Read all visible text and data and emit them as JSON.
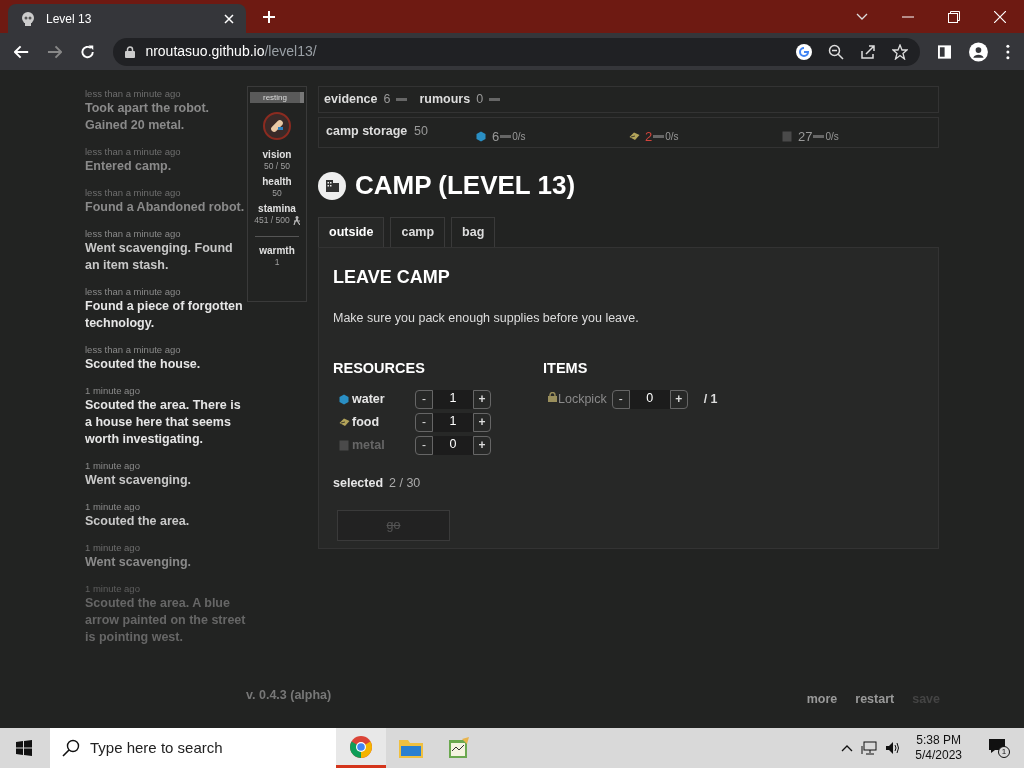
{
  "browser": {
    "tab_title": "Level 13",
    "url_host": "nroutasuo.github.io",
    "url_path": "/level13/"
  },
  "log": [
    {
      "time": "less than a minute ago",
      "text": "Took apart the robot. Gained 20 metal.",
      "kind": "dim"
    },
    {
      "time": "less than a minute ago",
      "text": "Entered camp.",
      "kind": "dim"
    },
    {
      "time": "less than a minute ago",
      "text": "Found a Abandoned robot.",
      "kind": "dim"
    },
    {
      "time": "less than a minute ago",
      "text": "Went scavenging. Found an item stash.",
      "kind": "normal"
    },
    {
      "time": "less than a minute ago",
      "text": "Found a piece of forgotten technology.",
      "kind": "bright"
    },
    {
      "time": "less than a minute ago",
      "text": "Scouted the house.",
      "kind": "bright"
    },
    {
      "time": "1 minute ago",
      "text": "Scouted the area. There is a house here that seems worth investigating.",
      "kind": "bright"
    },
    {
      "time": "1 minute ago",
      "text": "Went scavenging.",
      "kind": "normal"
    },
    {
      "time": "1 minute ago",
      "text": "Scouted the area.",
      "kind": "normal"
    },
    {
      "time": "1 minute ago",
      "text": "Went scavenging.",
      "kind": "dim"
    },
    {
      "time": "1 minute ago",
      "text": "Scouted the area. A blue arrow painted on the street is pointing west.",
      "kind": "faint"
    }
  ],
  "status": {
    "badge": "resting",
    "stats": [
      {
        "label": "vision",
        "value": "50 / 50"
      },
      {
        "label": "health",
        "value": "50"
      },
      {
        "label": "stamina",
        "value": "451 / 500"
      }
    ],
    "warmth": {
      "label": "warmth",
      "value": "1"
    }
  },
  "evidence": {
    "label": "evidence",
    "value": "6"
  },
  "rumours": {
    "label": "rumours",
    "value": "0"
  },
  "storage": {
    "label": "camp storage",
    "value": "50",
    "resources": [
      {
        "kind": "water",
        "amount": "6",
        "rate": "0/s",
        "color": "#2a8fc4",
        "warning": false
      },
      {
        "kind": "food",
        "amount": "2",
        "rate": "0/s",
        "color": "#b3a45a",
        "warning": true
      },
      {
        "kind": "metal",
        "amount": "27",
        "rate": "0/s",
        "color": "#4a4a4a",
        "warning": false
      }
    ]
  },
  "heading": "CAMP (LEVEL 13)",
  "tabs": [
    {
      "label": "outside",
      "selected": true
    },
    {
      "label": "camp",
      "selected": false
    },
    {
      "label": "bag",
      "selected": false
    }
  ],
  "panel": {
    "title": "LEAVE CAMP",
    "description": "Make sure you pack enough supplies before you leave.",
    "resources_title": "RESOURCES",
    "resources": [
      {
        "kind": "water",
        "name": "water",
        "value": "1",
        "color": "#2a8fc4",
        "disabled": false
      },
      {
        "kind": "food",
        "name": "food",
        "value": "1",
        "color": "#b3a45a",
        "disabled": false
      },
      {
        "kind": "metal",
        "name": "metal",
        "value": "0",
        "color": "#4a4a4a",
        "disabled": true
      }
    ],
    "minus": "-",
    "plus": "+",
    "items_title": "ITEMS",
    "items": [
      {
        "name": "Lockpick",
        "value": "0",
        "max": "/ 1"
      }
    ],
    "selected_label": "selected",
    "selected_value": "2 / 30",
    "go": {
      "label": "go",
      "disabled": true
    }
  },
  "footer": {
    "version": "v. 0.4.3 (alpha)",
    "links": [
      {
        "label": "more",
        "disabled": false
      },
      {
        "label": "restart",
        "disabled": false
      },
      {
        "label": "save",
        "disabled": true
      }
    ]
  },
  "taskbar": {
    "search_placeholder": "Type here to search",
    "time": "5:38 PM",
    "date": "5/4/2023",
    "notifications": "1"
  }
}
